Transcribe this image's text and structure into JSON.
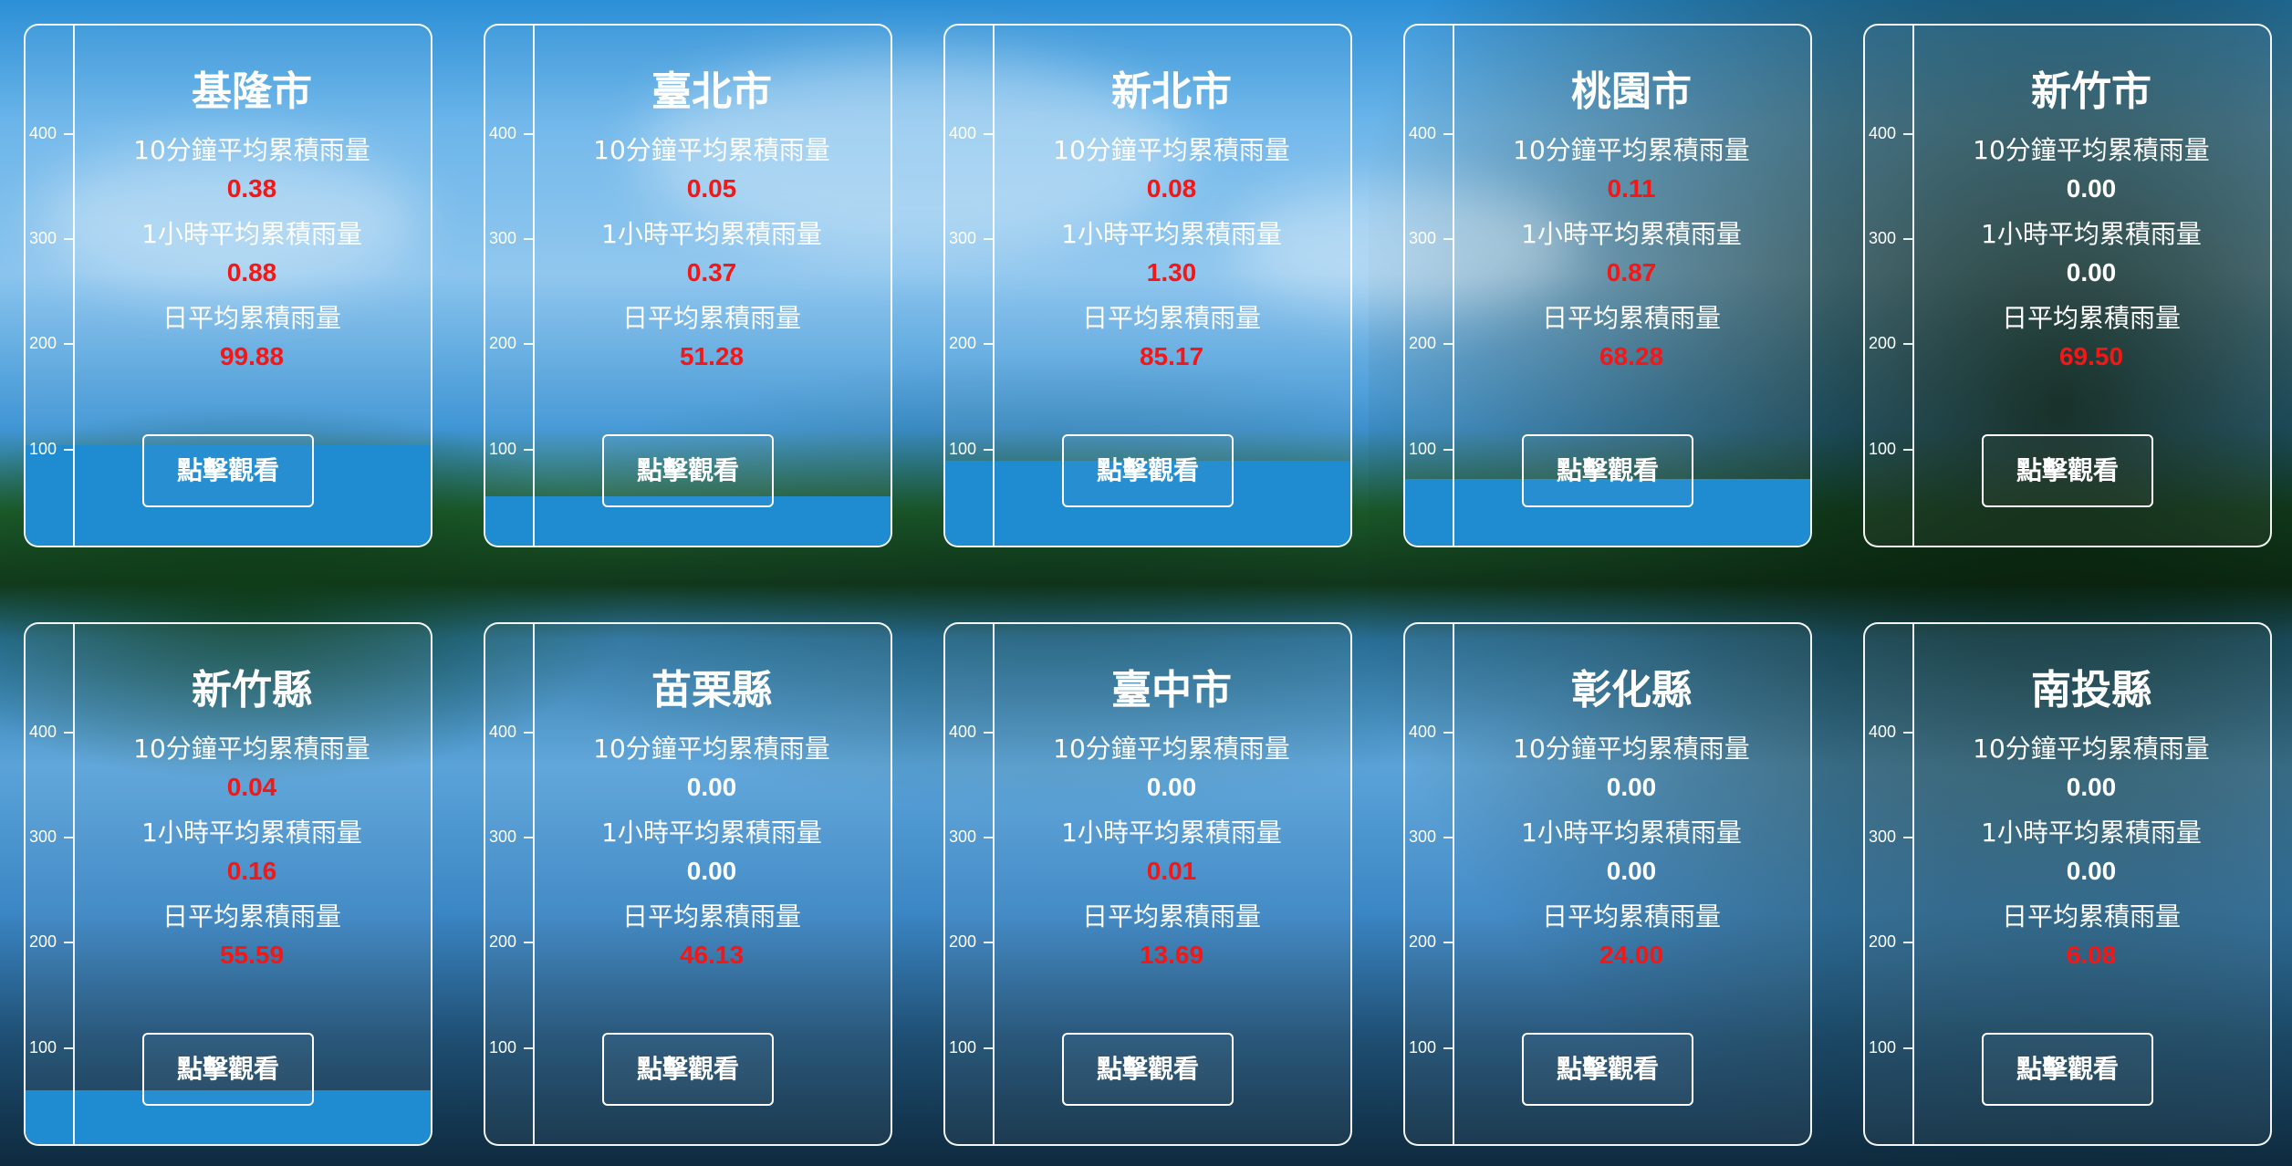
{
  "labels": {
    "ten_min": "10分鐘平均累積雨量",
    "one_hour": "1小時平均累積雨量",
    "daily": "日平均累積雨量",
    "button": "點擊觀看"
  },
  "axis_ticks": [
    "400",
    "300",
    "200",
    "100"
  ],
  "colors": {
    "nonzero_value": "#f51616",
    "zero_value": "#ffffff",
    "water": "#1f8bd0",
    "border": "#ffffff"
  },
  "cards": [
    {
      "name": "基隆市",
      "ten_min": "0.38",
      "one_hour": "0.88",
      "daily": "99.88",
      "water_level": 99.88
    },
    {
      "name": "臺北市",
      "ten_min": "0.05",
      "one_hour": "0.37",
      "daily": "51.28",
      "water_level": 51.28
    },
    {
      "name": "新北市",
      "ten_min": "0.08",
      "one_hour": "1.30",
      "daily": "85.17",
      "water_level": 85.17
    },
    {
      "name": "桃園市",
      "ten_min": "0.11",
      "one_hour": "0.87",
      "daily": "68.28",
      "water_level": 68.28
    },
    {
      "name": "新竹市",
      "ten_min": "0.00",
      "one_hour": "0.00",
      "daily": "69.50",
      "water_level": 0
    },
    {
      "name": "新竹縣",
      "ten_min": "0.04",
      "one_hour": "0.16",
      "daily": "55.59",
      "water_level": 55.59
    },
    {
      "name": "苗栗縣",
      "ten_min": "0.00",
      "one_hour": "0.00",
      "daily": "46.13",
      "water_level": 0
    },
    {
      "name": "臺中市",
      "ten_min": "0.00",
      "one_hour": "0.01",
      "daily": "13.69",
      "water_level": 0
    },
    {
      "name": "彰化縣",
      "ten_min": "0.00",
      "one_hour": "0.00",
      "daily": "24.00",
      "water_level": 0
    },
    {
      "name": "南投縣",
      "ten_min": "0.00",
      "one_hour": "0.00",
      "daily": "6.08",
      "water_level": 0
    }
  ]
}
